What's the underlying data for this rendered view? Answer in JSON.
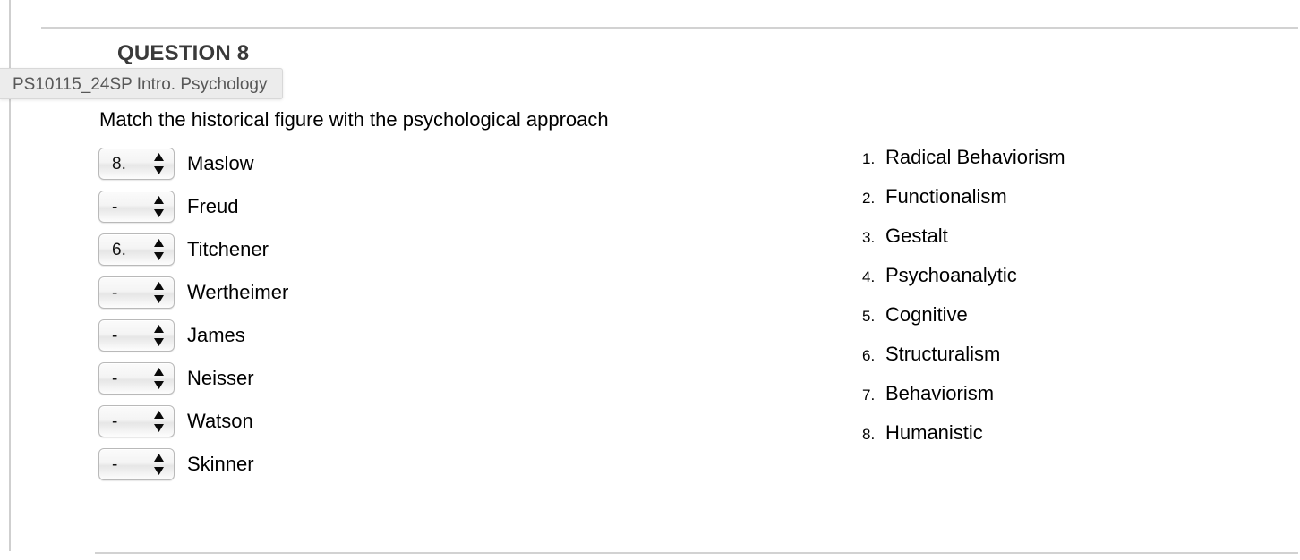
{
  "page": {
    "course_tooltip": "PS10115_24SP Intro. Psychology",
    "question_title": "QUESTION 8",
    "prompt": "Match the historical figure with the psychological approach",
    "rule_color": "#d2d2d2",
    "border_color": "#cfcfcf",
    "title_color": "#3a3a3a",
    "tooltip_bg": "#ececec",
    "tooltip_text_color": "#585858"
  },
  "matching": {
    "items": [
      {
        "value": "8.",
        "label": "Maslow"
      },
      {
        "value": "-",
        "label": "Freud"
      },
      {
        "value": "6.",
        "label": "Titchener"
      },
      {
        "value": "-",
        "label": "Wertheimer"
      },
      {
        "value": "-",
        "label": "James"
      },
      {
        "value": "-",
        "label": "Neisser"
      },
      {
        "value": "-",
        "label": "Watson"
      },
      {
        "value": "-",
        "label": "Skinner"
      }
    ],
    "placeholder": "-"
  },
  "options": {
    "items": [
      {
        "num": "1.",
        "text": "Radical Behaviorism"
      },
      {
        "num": "2.",
        "text": "Functionalism"
      },
      {
        "num": "3.",
        "text": "Gestalt"
      },
      {
        "num": "4.",
        "text": "Psychoanalytic"
      },
      {
        "num": "5.",
        "text": "Cognitive"
      },
      {
        "num": "6.",
        "text": "Structuralism"
      },
      {
        "num": "7.",
        "text": "Behaviorism"
      },
      {
        "num": "8.",
        "text": "Humanistic"
      }
    ]
  }
}
